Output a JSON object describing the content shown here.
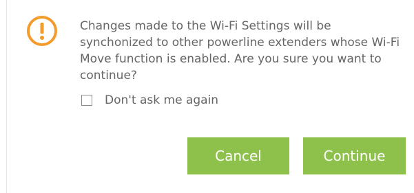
{
  "dialog": {
    "icon": "warning-exclamation-icon",
    "message": "Changes made to the Wi-Fi Settings will be synchonized to other powerline extenders whose Wi-Fi Move function is enabled. Are you sure you want to continue?",
    "dont_ask": {
      "label": "Don't ask me again",
      "checked": false
    },
    "buttons": {
      "cancel": "Cancel",
      "continue": "Continue"
    }
  },
  "colors": {
    "accent": "#8dc14b",
    "icon": "#f39c2b",
    "text": "#666666"
  }
}
